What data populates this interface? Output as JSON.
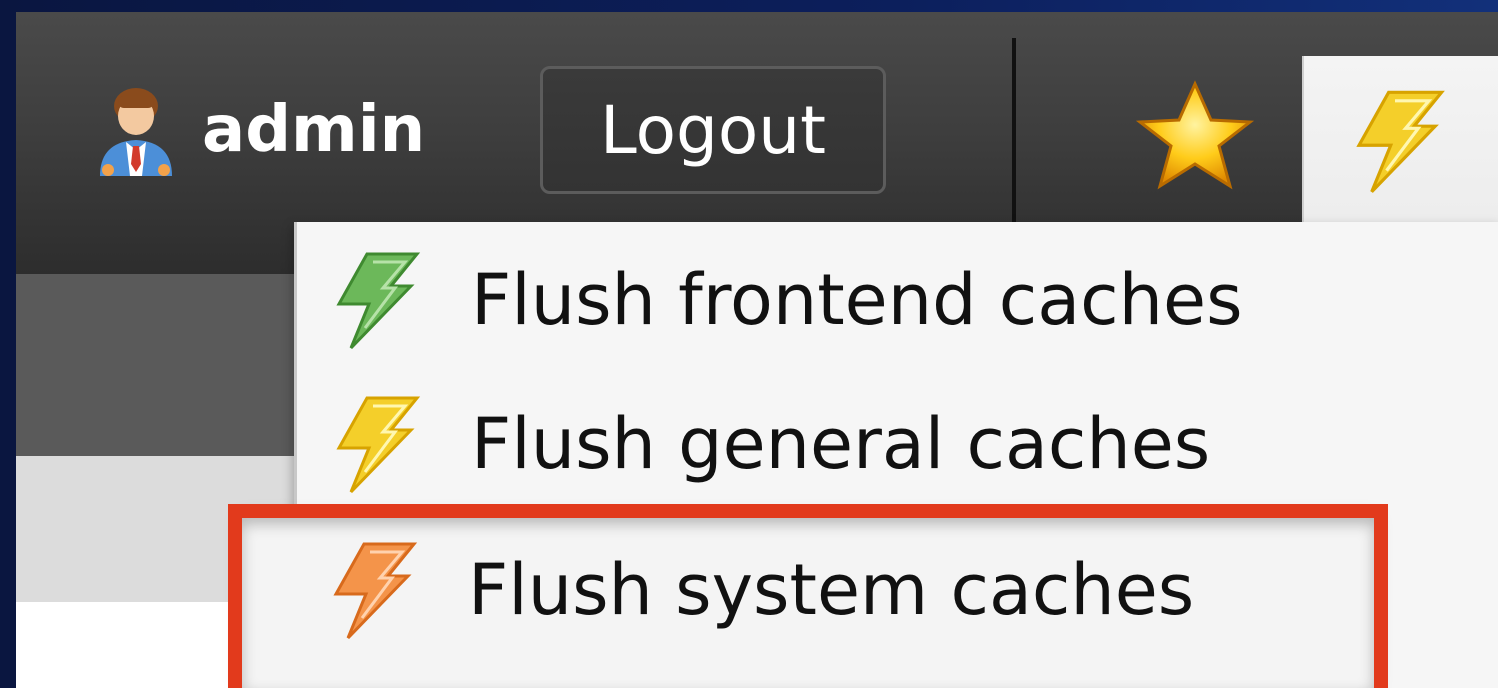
{
  "user": {
    "icon": "user-avatar-icon",
    "name": "admin"
  },
  "toolbar": {
    "logout_label": "Logout",
    "bookmarks_icon": "star-icon",
    "cache_icon": "lightning-icon"
  },
  "cache_menu": {
    "items": [
      {
        "label": "Flush frontend caches",
        "icon": "lightning-green-icon",
        "color": "#5aa548"
      },
      {
        "label": "Flush general caches",
        "icon": "lightning-yellow-icon",
        "color": "#f0c419"
      },
      {
        "label": "Flush system caches",
        "icon": "lightning-orange-icon",
        "color": "#f08a3c"
      }
    ],
    "highlighted_index": 2
  },
  "colors": {
    "highlight_border": "#e23a1c",
    "topbar": "#3e3e3e",
    "menu_bg": "#f6f6f6"
  }
}
